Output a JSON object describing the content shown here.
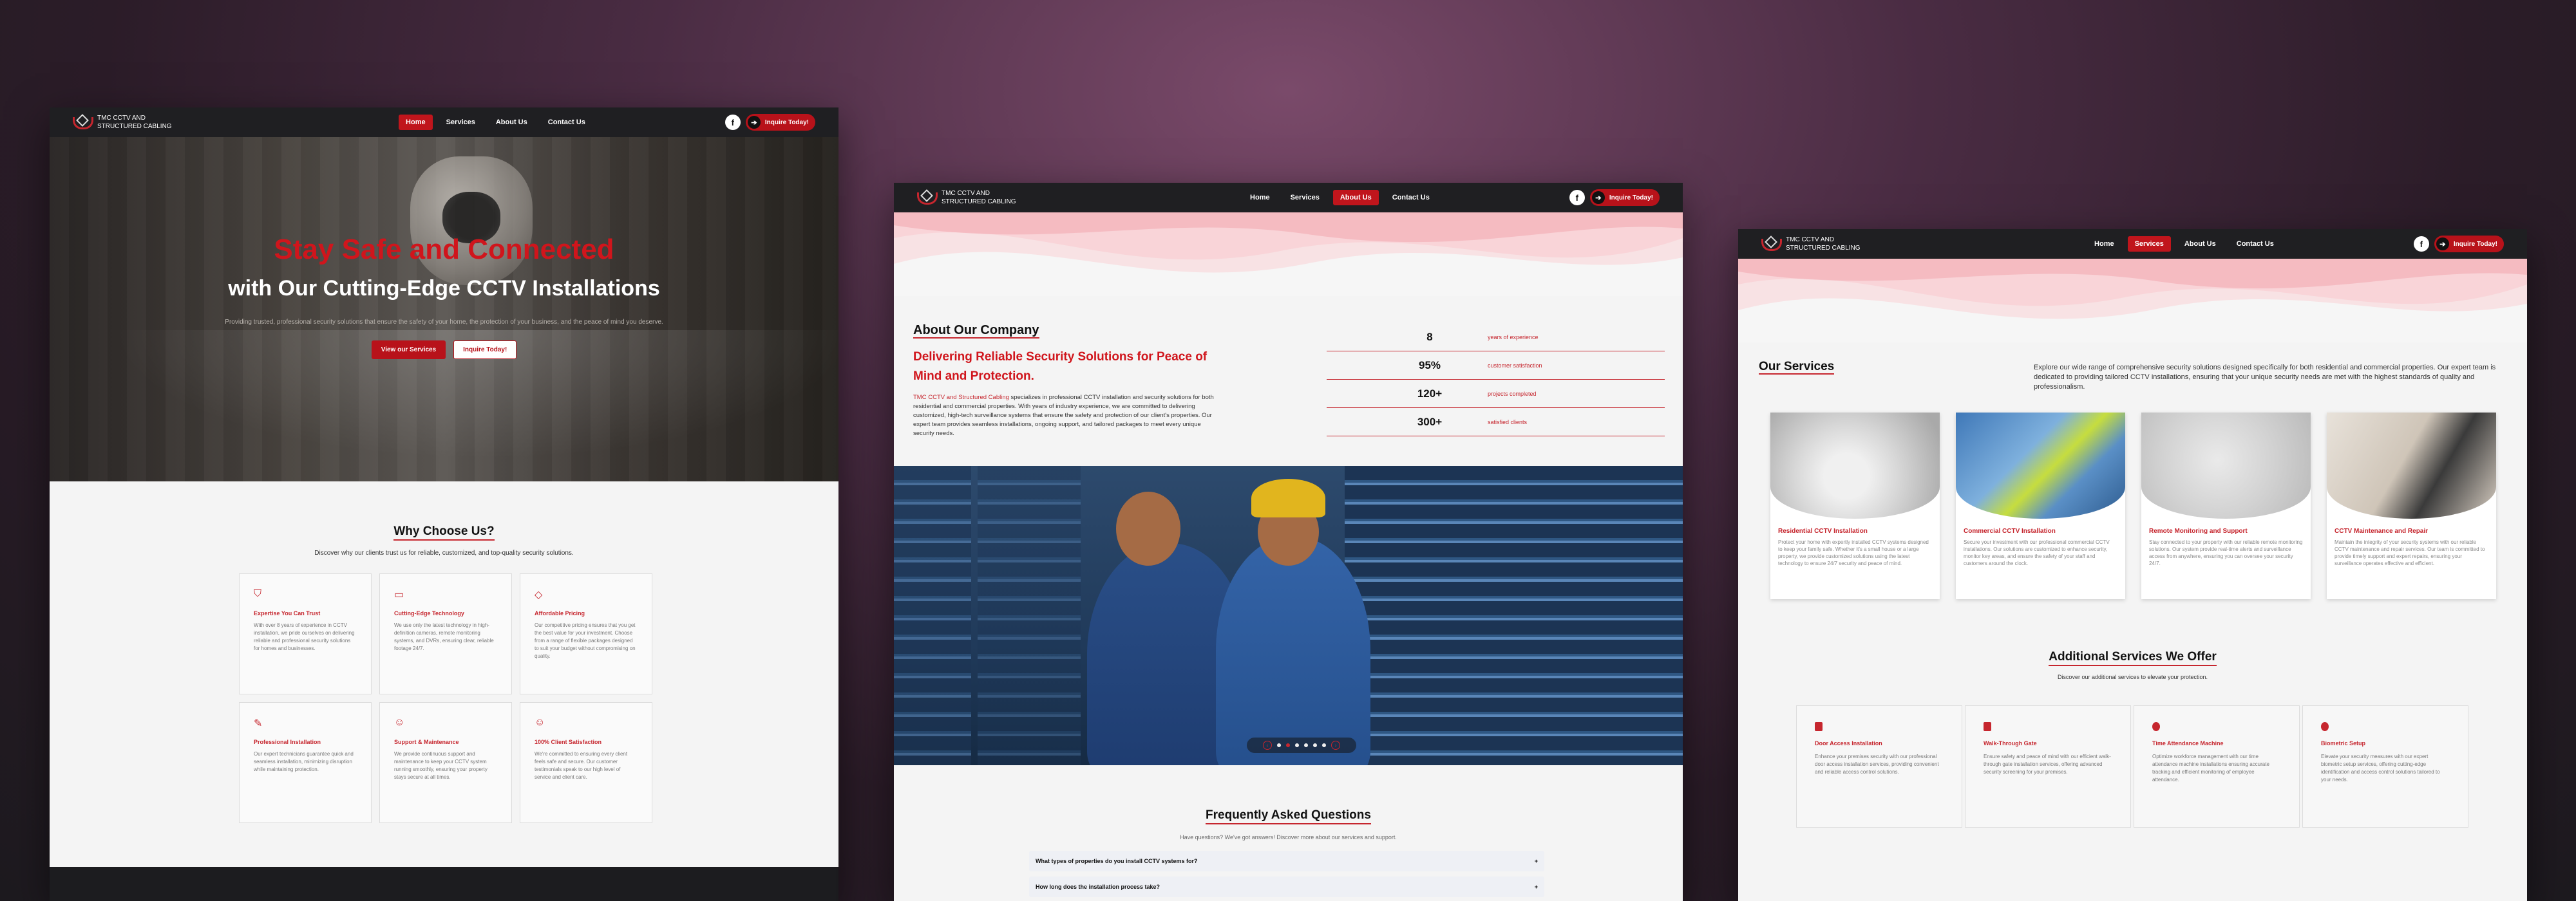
{
  "brand": {
    "name_line1": "TMC CCTV AND",
    "name_line2": "STRUCTURED CABLING"
  },
  "nav": {
    "items": [
      "Home",
      "Services",
      "About Us",
      "Contact Us"
    ],
    "facebook_icon": "f",
    "inquire_label": "Inquire Today!",
    "arrow": "➔"
  },
  "home": {
    "hero_title": "Stay Safe and Connected",
    "hero_subtitle": "with Our Cutting-Edge CCTV Installations",
    "hero_text": "Providing trusted, professional security solutions that ensure the safety of your home, the protection of your business, and the peace of mind you deserve.",
    "btn_services": "View our Services",
    "btn_inquire": "Inquire Today!",
    "why_title": "Why Choose Us?",
    "why_sub": "Discover why our clients trust us for reliable, customized, and top-quality security solutions.",
    "features": [
      {
        "icon": "shield-icon",
        "glyph": "⛉",
        "title": "Expertise You Can Trust",
        "text": "With over 8 years of experience in CCTV installation, we pride ourselves on delivering reliable and professional security solutions for homes and businesses."
      },
      {
        "icon": "camera-icon",
        "glyph": "▭",
        "title": "Cutting-Edge Technology",
        "text": "We use only the latest technology in high-definition cameras, remote monitoring systems, and DVRs, ensuring clear, reliable footage 24/7."
      },
      {
        "icon": "tag-icon",
        "glyph": "◇",
        "title": "Affordable Pricing",
        "text": "Our competitive pricing ensures that you get the best value for your investment. Choose from a range of flexible packages designed to suit your budget without compromising on quality."
      },
      {
        "icon": "wrench-icon",
        "glyph": "✎",
        "title": "Professional Installation",
        "text": "Our expert technicians guarantee quick and seamless installation, minimizing disruption while maintaining protection."
      },
      {
        "icon": "support-icon",
        "glyph": "☺",
        "title": "Support & Maintenance",
        "text": "We provide continuous support and maintenance to keep your CCTV system running smoothly, ensuring your property stays secure at all times."
      },
      {
        "icon": "smile-icon",
        "glyph": "☺",
        "title": "100% Client Satisfaction",
        "text": "We're committed to ensuring every client feels safe and secure. Our customer testimonials speak to our high level of service and client care."
      }
    ]
  },
  "about": {
    "title": "About Our Company",
    "tagline": "Delivering Reliable Security Solutions for Peace of Mind and Protection.",
    "body_highlight": "TMC CCTV and Structured Cabling",
    "body": " specializes in professional CCTV installation and security solutions for both residential and commercial properties. With years of industry experience, we are committed to delivering customized, high-tech surveillance systems that ensure the safety and protection of our client's properties. Our expert team provides seamless installations, ongoing support, and tailored packages to meet every unique security needs.",
    "stats": [
      {
        "value": "8",
        "label": "years of experience"
      },
      {
        "value": "95%",
        "label": "customer satisfaction"
      },
      {
        "value": "120+",
        "label": "projects completed"
      },
      {
        "value": "300+",
        "label": "satisfied clients"
      }
    ],
    "faq_title": "Frequently Asked Questions",
    "faq_sub": "Have questions? We've got answers! Discover more about our services and support.",
    "faqs": [
      {
        "q": "What types of properties do you install CCTV systems for?",
        "toggle": "+"
      },
      {
        "q": "How long does the installation process take?",
        "toggle": "+"
      }
    ],
    "carousel": {
      "slides": 6,
      "active": 2,
      "prev": "‹",
      "next": "›"
    }
  },
  "services": {
    "title": "Our Services",
    "intro": "Explore our wide range of comprehensive security solutions designed specifically for both residential and commercial properties. Our expert team is dedicated to providing tailored CCTV installations, ensuring that your unique security needs are met with the highest standards of quality and professionalism.",
    "cards": [
      {
        "title": "Residential CCTV Installation",
        "text": "Protect your home with expertly installed CCTV systems designed to keep your family safe. Whether it's a small house or a large property, we provide customized solutions using the latest technology to ensure 24/7 security and peace of mind."
      },
      {
        "title": "Commercial CCTV Installation",
        "text": "Secure your investment with our professional commercial CCTV installations. Our solutions are customized to enhance security, monitor key areas, and ensure the safety of your staff and customers around the clock."
      },
      {
        "title": "Remote Monitoring and Support",
        "text": "Stay connected to your property with our reliable remote monitoring solutions. Our system provide real-time alerts and surveillance access from anywhere, ensuring you can oversee your security 24/7."
      },
      {
        "title": "CCTV Maintenance and Repair",
        "text": "Maintain the integrity of your security systems with our reliable CCTV maintenance and repair services. Our team is committed to provide timely support and expert repairs, ensuring your surveillance operates effective and efficient."
      }
    ],
    "additional_title": "Additional Services We Offer",
    "additional_sub": "Discover our additional services to elevate your protection.",
    "additional": [
      {
        "title": "Door Access Installation",
        "text": "Enhance your premises security with our professional door access installation services, providing convenient and reliable access control solutions."
      },
      {
        "title": "Walk-Through Gate",
        "text": "Ensure safety and peace of mind with our efficient walk-through gate installation services, offering advanced security screening for your premises."
      },
      {
        "title": "Time Attendance Machine",
        "text": "Optimize workforce management with our time attendance machine installations ensuring accurate tracking and efficient monitoring of employee attendance."
      },
      {
        "title": "Biometric Setup",
        "text": "Elevate your security measures with our expert biometric setup services, offering cutting-edge identification and access control solutions tailored to your needs."
      }
    ]
  }
}
